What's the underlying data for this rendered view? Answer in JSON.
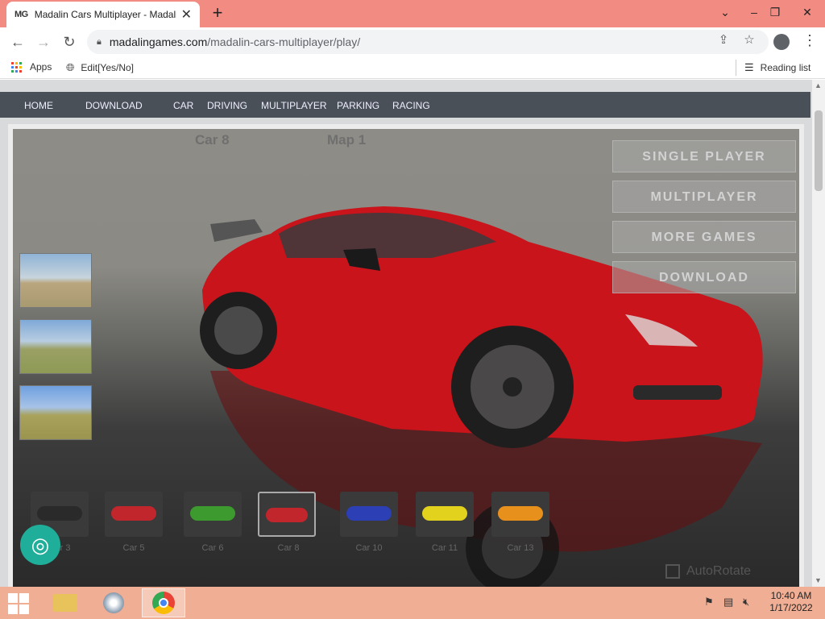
{
  "browser": {
    "tab_favicon": "MG",
    "tab_title": "Madalin Cars Multiplayer - Madalin",
    "tab_close": "✕",
    "new_tab": "+",
    "url_host": "madalingames.com",
    "url_path": "/madalin-cars-multiplayer/play/",
    "bookmarks": {
      "apps": "Apps",
      "edit": "Edit[Yes/No]",
      "reading_list": "Reading list"
    }
  },
  "site_nav": [
    "HOME",
    "DOWNLOAD",
    "CAR",
    "DRIVING",
    "MULTIPLAYER",
    "PARKING",
    "RACING"
  ],
  "game": {
    "selected_car": "Car 8",
    "selected_map": "Map 1",
    "menu": {
      "single_player": "SINGLE PLAYER",
      "multiplayer": "MULTIPLAYER",
      "more_games": "MORE GAMES",
      "download": "DOWNLOAD"
    },
    "car_list": [
      {
        "label": "Car 3",
        "color": "#2a2a2a"
      },
      {
        "label": "Car 5",
        "color": "#c0262c"
      },
      {
        "label": "Car 6",
        "color": "#3c9a2e"
      },
      {
        "label": "Car 8",
        "color": "#c0262c"
      },
      {
        "label": "Car 10",
        "color": "#2c3fb4"
      },
      {
        "label": "Car 11",
        "color": "#e2d21e"
      },
      {
        "label": "Car 13",
        "color": "#e8901c"
      }
    ],
    "autorotate": "AutoRotate"
  },
  "taskbar": {
    "time": "10:40 AM",
    "date": "1/17/2022"
  },
  "colors": {
    "tabstrip": "#f28b82",
    "site_nav": "#4a5057",
    "car_body": "#c8141a",
    "taskbar": "#f0ae94"
  }
}
